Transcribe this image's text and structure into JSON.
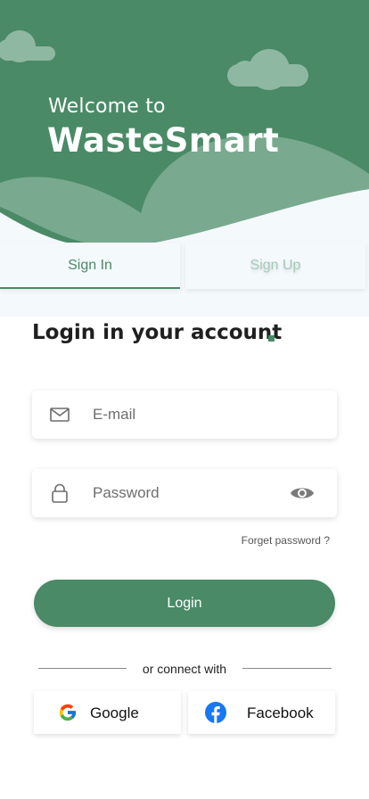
{
  "header": {
    "welcome": "Welcome to",
    "app_name": "WasteSmart"
  },
  "tabs": [
    {
      "label": "Sign In",
      "active": true
    },
    {
      "label": "Sign Up",
      "active": false
    }
  ],
  "form": {
    "title": "Login in your account",
    "email": {
      "placeholder": "E-mail",
      "value": "",
      "icon": "mail-icon"
    },
    "password": {
      "placeholder": "Password",
      "value": "",
      "icon": "lock-icon",
      "toggle_icon": "eye-icon"
    },
    "forget_label": "Forget password ?",
    "login_label": "Login"
  },
  "social": {
    "divider_label": "or connect with",
    "google_label": "Google",
    "facebook_label": "Facebook"
  },
  "colors": {
    "primary": "#4a8a67",
    "primary_light": "#7aa98f",
    "cloud": "#8fb8a2",
    "surface": "#f4f9fc",
    "facebook": "#1877f2"
  }
}
